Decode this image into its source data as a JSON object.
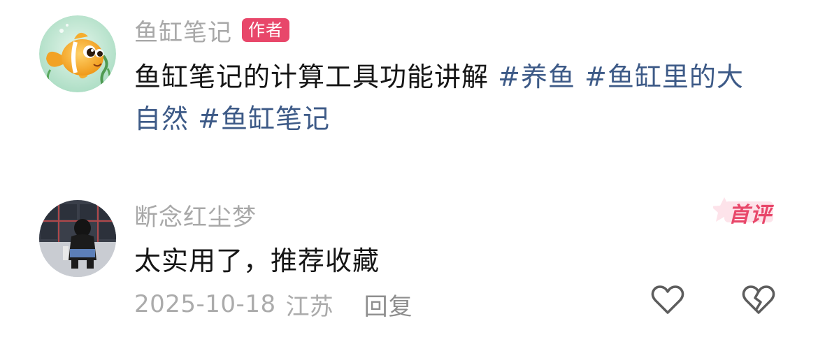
{
  "post": {
    "author_name": "鱼缸笔记",
    "author_badge": "作者",
    "text": "鱼缸笔记的计算工具功能讲解",
    "hashtags": [
      "#养鱼",
      "#鱼缸里的大自然",
      "#鱼缸笔记"
    ],
    "avatar_icon": "goldfish-avatar-icon"
  },
  "comment": {
    "username": "断念红尘梦",
    "badge": "首评",
    "text": "太实用了，推荐收藏",
    "date": "2025-10-18",
    "location": "江苏",
    "reply_label": "回复",
    "like_icon": "heart-icon",
    "dislike_icon": "broken-heart-icon",
    "avatar_icon": "user-photo-avatar"
  },
  "colors": {
    "tag": "#3d5a87",
    "badge": "#e8476a",
    "muted_text": "#a8a8a8",
    "primary_text": "#151515"
  }
}
